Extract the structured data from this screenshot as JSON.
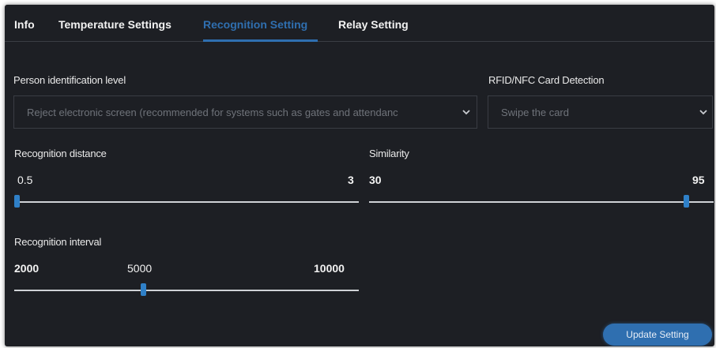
{
  "tabs": [
    {
      "label": "Info"
    },
    {
      "label": "Temperature Settings"
    },
    {
      "label": "Recognition Setting"
    },
    {
      "label": "Relay Setting"
    }
  ],
  "active_tab": "Recognition Setting",
  "colors": {
    "accent": "#2f6fb0",
    "panel_bg": "#1d1f24",
    "slider_thumb": "#2f80c8"
  },
  "person_identification": {
    "label": "Person identification level",
    "selected": "Reject electronic screen (recommended for systems such as gates and attendanc",
    "icon": "chevron-down-icon"
  },
  "card_detection": {
    "label": "RFID/NFC Card Detection",
    "selected": "Swipe the card",
    "icon": "chevron-down-icon"
  },
  "recognition_distance": {
    "label": "Recognition distance",
    "min": "0.5",
    "max": "3",
    "value": 0.5
  },
  "similarity": {
    "label": "Similarity",
    "min": "30",
    "max": "95",
    "value": 95
  },
  "recognition_interval": {
    "label": "Recognition interval",
    "min": "2000",
    "current": "5000",
    "max": "10000",
    "value": 5000
  },
  "update_button": {
    "label": "Update Setting"
  }
}
